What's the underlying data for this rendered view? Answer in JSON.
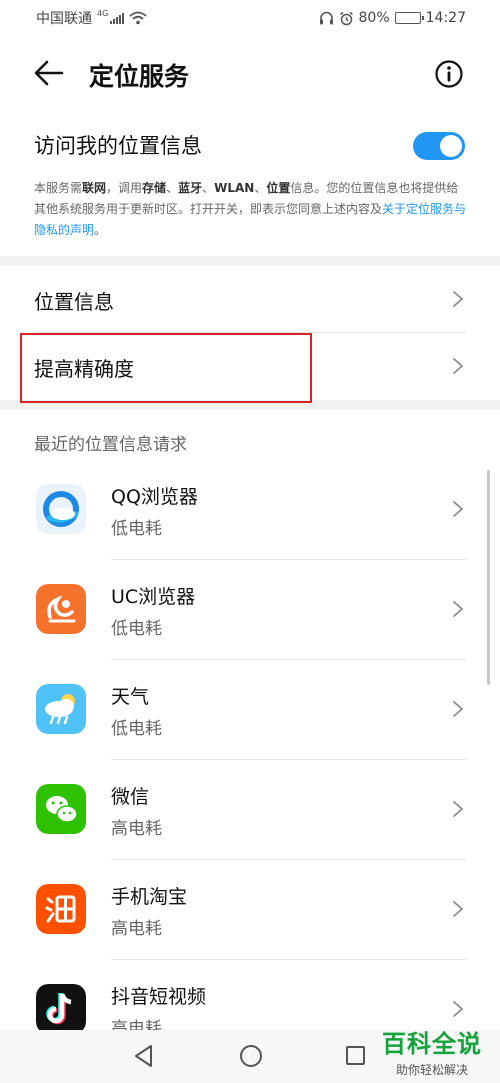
{
  "status": {
    "carrier": "中国联通",
    "network": "4G",
    "battery": "80%",
    "battery_level": 0.8,
    "time": "14:27"
  },
  "header": {
    "title": "定位服务"
  },
  "location_access": {
    "label": "访问我的位置信息",
    "enabled": true,
    "description": {
      "p1": "本服务需",
      "b1": "联网",
      "p2": "，调用",
      "b2": "存储",
      "p3": "、",
      "b3": "蓝牙",
      "p4": "、",
      "b4": "WLAN",
      "p5": "、",
      "b5": "位置",
      "p6": "信息。您的位置信息也将提供给其他系统服务用于更新时区。打开开关，即表示您同意上述内容及",
      "link": "关于定位服务与隐私的声明",
      "end": "。"
    }
  },
  "settings": {
    "location_info": "位置信息",
    "improve_accuracy": "提高精确度"
  },
  "recent": {
    "header": "最近的位置信息请求",
    "apps": [
      {
        "name": "QQ浏览器",
        "power": "低电耗",
        "icon": "qq-browser-icon"
      },
      {
        "name": "UC浏览器",
        "power": "低电耗",
        "icon": "uc-browser-icon"
      },
      {
        "name": "天气",
        "power": "低电耗",
        "icon": "weather-icon"
      },
      {
        "name": "微信",
        "power": "高电耗",
        "icon": "wechat-icon"
      },
      {
        "name": "手机淘宝",
        "power": "高电耗",
        "icon": "taobao-icon"
      },
      {
        "name": "抖音短视频",
        "power": "高电耗",
        "icon": "douyin-icon"
      }
    ]
  },
  "watermark": {
    "title": "百科全说",
    "subtitle": "助你轻松解决"
  },
  "colors": {
    "accent": "#2196f3",
    "highlight": "#d4262b",
    "watermark_green": "#14a33a"
  }
}
